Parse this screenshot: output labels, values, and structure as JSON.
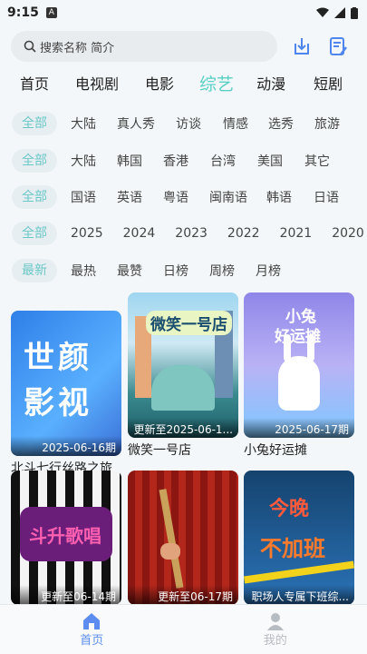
{
  "status": {
    "time": "9:15",
    "sim_badge": "A"
  },
  "search": {
    "placeholder": "搜索名称 简介"
  },
  "icons": {
    "search": "search-icon",
    "download": "download-icon",
    "history": "history-icon",
    "home": "home-icon",
    "profile": "person-icon"
  },
  "category_tabs": [
    "首页",
    "电视剧",
    "电影",
    "综艺",
    "动漫",
    "短剧"
  ],
  "active_category": "综艺",
  "filters": {
    "region": {
      "chip": "全部",
      "options": [
        "大陆",
        "真人秀",
        "访谈",
        "情感",
        "选秀",
        "旅游"
      ]
    },
    "country": {
      "chip": "全部",
      "options": [
        "大陆",
        "韩国",
        "香港",
        "台湾",
        "美国",
        "其它"
      ]
    },
    "language": {
      "chip": "全部",
      "options": [
        "国语",
        "英语",
        "粤语",
        "闽南语",
        "韩语",
        "日语"
      ]
    },
    "year": {
      "chip": "全部",
      "options": [
        "2025",
        "2024",
        "2023",
        "2022",
        "2021",
        "2020"
      ]
    },
    "sort": {
      "chip": "最新",
      "options": [
        "最热",
        "最赞",
        "日榜",
        "周榜",
        "月榜"
      ]
    }
  },
  "cards": [
    {
      "title": "北斗七行丝路之旅",
      "caption": "2025-06-16期",
      "poster_text_1": "世颜",
      "poster_text_2": "影视"
    },
    {
      "title": "微笑一号店",
      "caption": "更新至2025-06-1...",
      "poster_text_1": "微笑一号店"
    },
    {
      "title": "小兔好运摊",
      "caption": "2025-06-17期",
      "poster_text_1": "小兔",
      "poster_text_2": "好运摊"
    },
    {
      "title": "",
      "caption": "更新至06-14期",
      "poster_text_1": "斗升歌唱"
    },
    {
      "title": "",
      "caption": "更新至06-17期",
      "poster_text_1": ""
    },
    {
      "title": "",
      "caption": "职场人专属下班综...",
      "poster_text_1": "今晚",
      "poster_text_2": "不加班"
    }
  ],
  "bottom_nav": {
    "home_label": "首页",
    "profile_label": "我的"
  },
  "colors": {
    "accent": "#58d0c5",
    "nav_active": "#5d8cf0"
  }
}
